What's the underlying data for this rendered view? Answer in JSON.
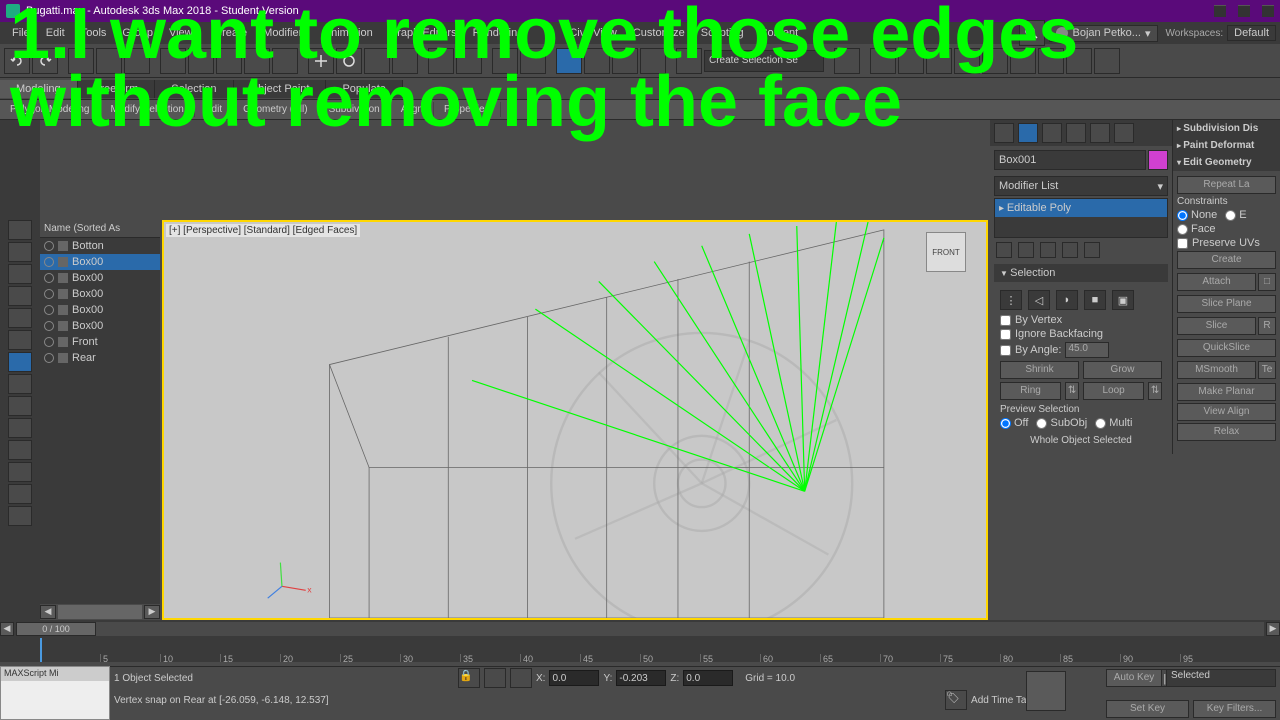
{
  "title": "Bugatti.max - Autodesk 3ds Max 2018 - Student Version",
  "overlay": "1.I want to remove those edges without removing the face",
  "menu": [
    "File",
    "Edit",
    "Tools",
    "Group",
    "Views",
    "Create",
    "Modifiers",
    "Animation",
    "Graph Editors",
    "Rendering",
    "Civil View",
    "Customize",
    "Scripting",
    "Content"
  ],
  "user": "Bojan Petko...",
  "workspace_label": "Workspaces:",
  "workspace_sel": "Default",
  "selectionset": "Create Selection Se",
  "ribbon_tabs": [
    "Modeling",
    "Freeform",
    "Selection",
    "Object Paint",
    "Populate"
  ],
  "subribbon": [
    "Polygon Modeling",
    "Modify Selection",
    "Edit",
    "Geometry (All)",
    "Subdivision",
    "Align",
    "Properties"
  ],
  "scene_head": "Name (Sorted As",
  "scene_items": [
    "Botton",
    "Box00",
    "Box00",
    "Box00",
    "Box00",
    "Box00",
    "Front",
    "Rear"
  ],
  "scene_selected_index": 1,
  "viewport_label": "[+] [Perspective] [Standard] [Edged Faces]",
  "viewcube_face": "FRONT",
  "obj_name": "Box001",
  "modlist_label": "Modifier List",
  "modstack_item": "Editable Poly",
  "rollout_rightcol": [
    "Subdivision Dis",
    "Paint Deformat",
    "Edit Geometry"
  ],
  "edit_geom": {
    "repeat": "Repeat La",
    "constraints_label": "Constraints",
    "constraint_none": "None",
    "constraint_e": "E",
    "constraint_face": "Face",
    "preserve": "Preserve UVs",
    "create": "Create",
    "attach": "Attach",
    "slice_plane": "Slice Plane",
    "slice": "Slice",
    "slice_r": "R",
    "quickslice": "QuickSlice",
    "msmooth": "MSmooth",
    "te": "Te",
    "make_planar": "Make Planar",
    "view_align": "View Align",
    "relax": "Relax"
  },
  "selection_rollout": "Selection",
  "selection": {
    "by_vertex": "By Vertex",
    "ignore_backfacing": "Ignore Backfacing",
    "by_angle": "By Angle:",
    "angle_val": "45.0",
    "shrink": "Shrink",
    "grow": "Grow",
    "ring": "Ring",
    "loop": "Loop",
    "preview_label": "Preview Selection",
    "off": "Off",
    "subobj": "SubObj",
    "multi": "Multi",
    "whole": "Whole Object Selected"
  },
  "timeline": {
    "current": "0 / 100",
    "ticks": [
      5,
      10,
      15,
      20,
      25,
      30,
      35,
      40,
      45,
      50,
      55,
      60,
      65,
      70,
      75,
      80,
      85,
      90,
      95
    ]
  },
  "maxscript": "MAXScript Mi",
  "status": {
    "sel": "1 Object Selected",
    "snap": "Vertex snap on Rear at [-26.059, -6.148, 12.537]",
    "x_label": "X:",
    "x": "0.0",
    "y_label": "Y:",
    "y": "-0.203",
    "z_label": "Z:",
    "z": "0.0",
    "grid_label": "Grid = 10.0",
    "autokey": "Auto Key",
    "selected": "Selected",
    "setkey": "Set Key",
    "keyfilters": "Key Filters...",
    "addtag": "Add Time Tag"
  },
  "chart_data": {}
}
